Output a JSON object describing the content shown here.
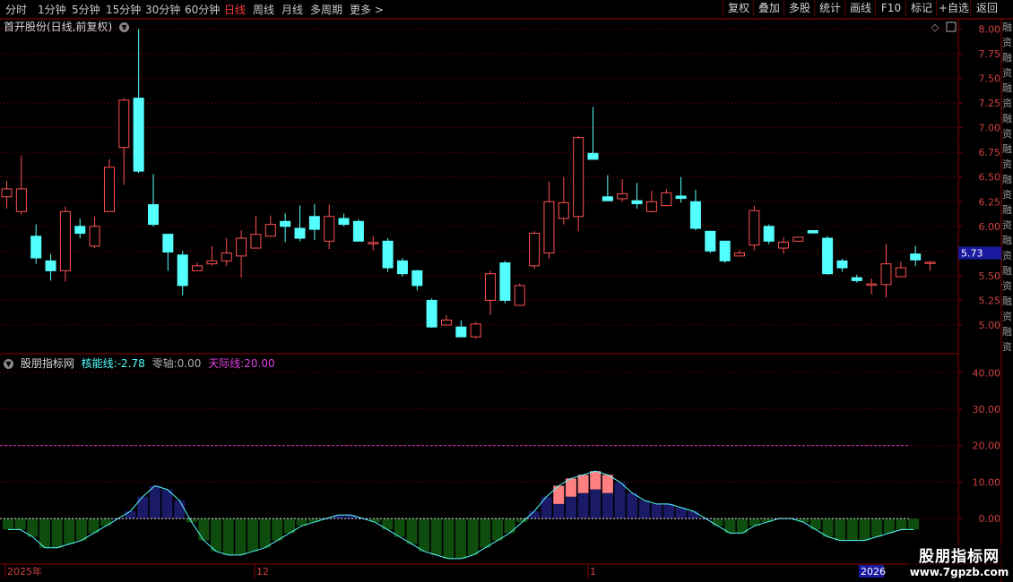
{
  "toolbar": {
    "periods": [
      "分时",
      "1分钟",
      "5分钟",
      "15分钟",
      "30分钟",
      "60分钟",
      "日线",
      "周线",
      "月线",
      "多周期",
      "更多 >"
    ],
    "active_period": "日线",
    "buttons": [
      "复权",
      "叠加",
      "多股",
      "统计",
      "画线",
      "F10",
      "标记",
      "+自选",
      "返回"
    ]
  },
  "main": {
    "title": "首开股份(日线,前复权)",
    "price_axis": [
      "8.00",
      "7.75",
      "7.50",
      "7.25",
      "7.00",
      "6.75",
      "6.50",
      "6.25",
      "6.00",
      "5.75",
      "5.50",
      "5.25",
      "5.00"
    ],
    "current_price": "5.73",
    "price_range": [
      4.8,
      8.05
    ]
  },
  "indicator": {
    "name": "股朋指标网",
    "core_label": "核能线:",
    "core_value": "-2.78",
    "zero_label": "零轴:",
    "zero_value": "0.00",
    "sky_label": "天际线:",
    "sky_value": "20.00",
    "axis": [
      "40.00",
      "30.00",
      "20.00",
      "10.00",
      "0.00"
    ],
    "range": [
      -12,
      44
    ]
  },
  "time_axis": {
    "labels": [
      "2025年",
      "12",
      "1"
    ],
    "end_label": "2026"
  },
  "colors": {
    "up": "#ff5050",
    "down": "#54ffff",
    "grid": "#8a0000",
    "core": "#54ffff",
    "sky": "#cc33cc",
    "bar_pos": "#1a1a66",
    "bar_neg": "#0f4d0f",
    "bar_hot": "#ff8080"
  },
  "right_strip_text": [
    "融",
    "资",
    "融",
    "资",
    "融",
    "资",
    "融",
    "资",
    "融",
    "资",
    "融",
    "资",
    "融",
    "资",
    "融",
    "资",
    "融",
    "资",
    "融",
    "资",
    "融",
    "资"
  ],
  "watermark": {
    "line1": "股朋指标网",
    "line2": "www.7gpzb.com"
  },
  "chart_data": {
    "type": "candlestick",
    "candles": [
      [
        6.3,
        6.38,
        6.46,
        6.18
      ],
      [
        6.15,
        6.38,
        6.72,
        6.12
      ],
      [
        5.9,
        5.68,
        6.02,
        5.62
      ],
      [
        5.65,
        5.55,
        5.72,
        5.45
      ],
      [
        5.55,
        6.15,
        6.2,
        5.44
      ],
      [
        6.0,
        5.93,
        6.08,
        5.88
      ],
      [
        5.8,
        6.0,
        6.1,
        5.78
      ],
      [
        6.15,
        6.6,
        6.68,
        6.15
      ],
      [
        6.8,
        7.28,
        7.3,
        6.42
      ],
      [
        7.3,
        6.56,
        8.0,
        6.54
      ],
      [
        6.22,
        6.02,
        6.53,
        6.0
      ],
      [
        5.92,
        5.74,
        5.92,
        5.55
      ],
      [
        5.71,
        5.4,
        5.75,
        5.3
      ],
      [
        5.55,
        5.6,
        5.63,
        5.55
      ],
      [
        5.62,
        5.65,
        5.8,
        5.6
      ],
      [
        5.65,
        5.73,
        5.88,
        5.6
      ],
      [
        5.7,
        5.88,
        5.96,
        5.48
      ],
      [
        5.78,
        5.92,
        6.11,
        5.78
      ],
      [
        5.9,
        6.02,
        6.11,
        5.9
      ],
      [
        6.05,
        6.0,
        6.13,
        5.84
      ],
      [
        5.98,
        5.88,
        6.21,
        5.85
      ],
      [
        6.1,
        5.97,
        6.23,
        5.86
      ],
      [
        5.85,
        6.1,
        6.22,
        5.77
      ],
      [
        6.08,
        6.02,
        6.13,
        6.0
      ],
      [
        6.05,
        5.85,
        6.07,
        5.85
      ],
      [
        5.83,
        5.83,
        5.9,
        5.76
      ],
      [
        5.85,
        5.58,
        5.88,
        5.54
      ],
      [
        5.65,
        5.52,
        5.68,
        5.49
      ],
      [
        5.55,
        5.4,
        5.56,
        5.35
      ],
      [
        5.25,
        4.98,
        5.27,
        4.97
      ],
      [
        5.0,
        5.05,
        5.1,
        5.0
      ],
      [
        4.98,
        4.88,
        5.05,
        4.88
      ],
      [
        4.88,
        5.01,
        5.03,
        4.86
      ],
      [
        5.25,
        5.52,
        5.55,
        5.1
      ],
      [
        5.63,
        5.25,
        5.65,
        5.22
      ],
      [
        5.2,
        5.4,
        5.42,
        5.2
      ],
      [
        5.6,
        5.93,
        5.95,
        5.57
      ],
      [
        5.73,
        6.25,
        6.45,
        5.67
      ],
      [
        6.08,
        6.24,
        6.5,
        6.02
      ],
      [
        6.1,
        6.9,
        6.92,
        5.95
      ],
      [
        6.74,
        6.68,
        7.21,
        6.74
      ],
      [
        6.3,
        6.26,
        6.52,
        6.26
      ],
      [
        6.28,
        6.33,
        6.48,
        6.25
      ],
      [
        6.26,
        6.23,
        6.44,
        6.18
      ],
      [
        6.15,
        6.25,
        6.36,
        6.14
      ],
      [
        6.21,
        6.34,
        6.38,
        6.21
      ],
      [
        6.3,
        6.29,
        6.5,
        6.24
      ],
      [
        6.25,
        5.98,
        6.37,
        5.96
      ],
      [
        5.95,
        5.75,
        5.95,
        5.73
      ],
      [
        5.85,
        5.65,
        5.85,
        5.63
      ],
      [
        5.7,
        5.73,
        5.76,
        5.7
      ],
      [
        5.81,
        6.16,
        6.21,
        5.76
      ],
      [
        6.0,
        5.85,
        6.02,
        5.82
      ],
      [
        5.78,
        5.84,
        5.89,
        5.72
      ],
      [
        5.85,
        5.89,
        5.89,
        5.85
      ],
      [
        5.95,
        5.94,
        5.96,
        5.93
      ],
      [
        5.88,
        5.52,
        5.9,
        5.51
      ],
      [
        5.65,
        5.58,
        5.67,
        5.54
      ],
      [
        5.48,
        5.45,
        5.51,
        5.43
      ],
      [
        5.41,
        5.41,
        5.47,
        5.31
      ],
      [
        5.41,
        5.62,
        5.82,
        5.28
      ],
      [
        5.49,
        5.58,
        5.64,
        5.49
      ],
      [
        5.72,
        5.66,
        5.8,
        5.6
      ],
      [
        5.63,
        5.63,
        5.65,
        5.55
      ]
    ],
    "indicator_bars": [
      -3,
      -3,
      -5,
      -8,
      -8,
      -7,
      -6,
      -4,
      -2,
      0,
      2,
      6,
      9,
      8,
      5,
      -1,
      -6,
      -9,
      -10,
      -10,
      -9,
      -8,
      -6,
      -4,
      -2,
      -1,
      0,
      1,
      1,
      0,
      -1,
      -3,
      -5,
      -7,
      -9,
      -10,
      -11,
      -11,
      -10,
      -8,
      -6,
      -4,
      -1,
      2,
      6,
      9,
      11,
      12,
      13,
      12,
      10,
      7,
      5,
      4,
      4,
      3,
      2,
      0,
      -2,
      -4,
      -4,
      -2,
      -1,
      0,
      0,
      -1,
      -3,
      -5,
      -6,
      -6,
      -6,
      -5,
      -4,
      -3,
      -3
    ],
    "hot_bars": [
      [
        36,
        1
      ],
      [
        37,
        1
      ],
      [
        38,
        1
      ],
      [
        39,
        1
      ],
      [
        40,
        1
      ]
    ],
    "sky_level": 20,
    "zero_level": 0
  }
}
